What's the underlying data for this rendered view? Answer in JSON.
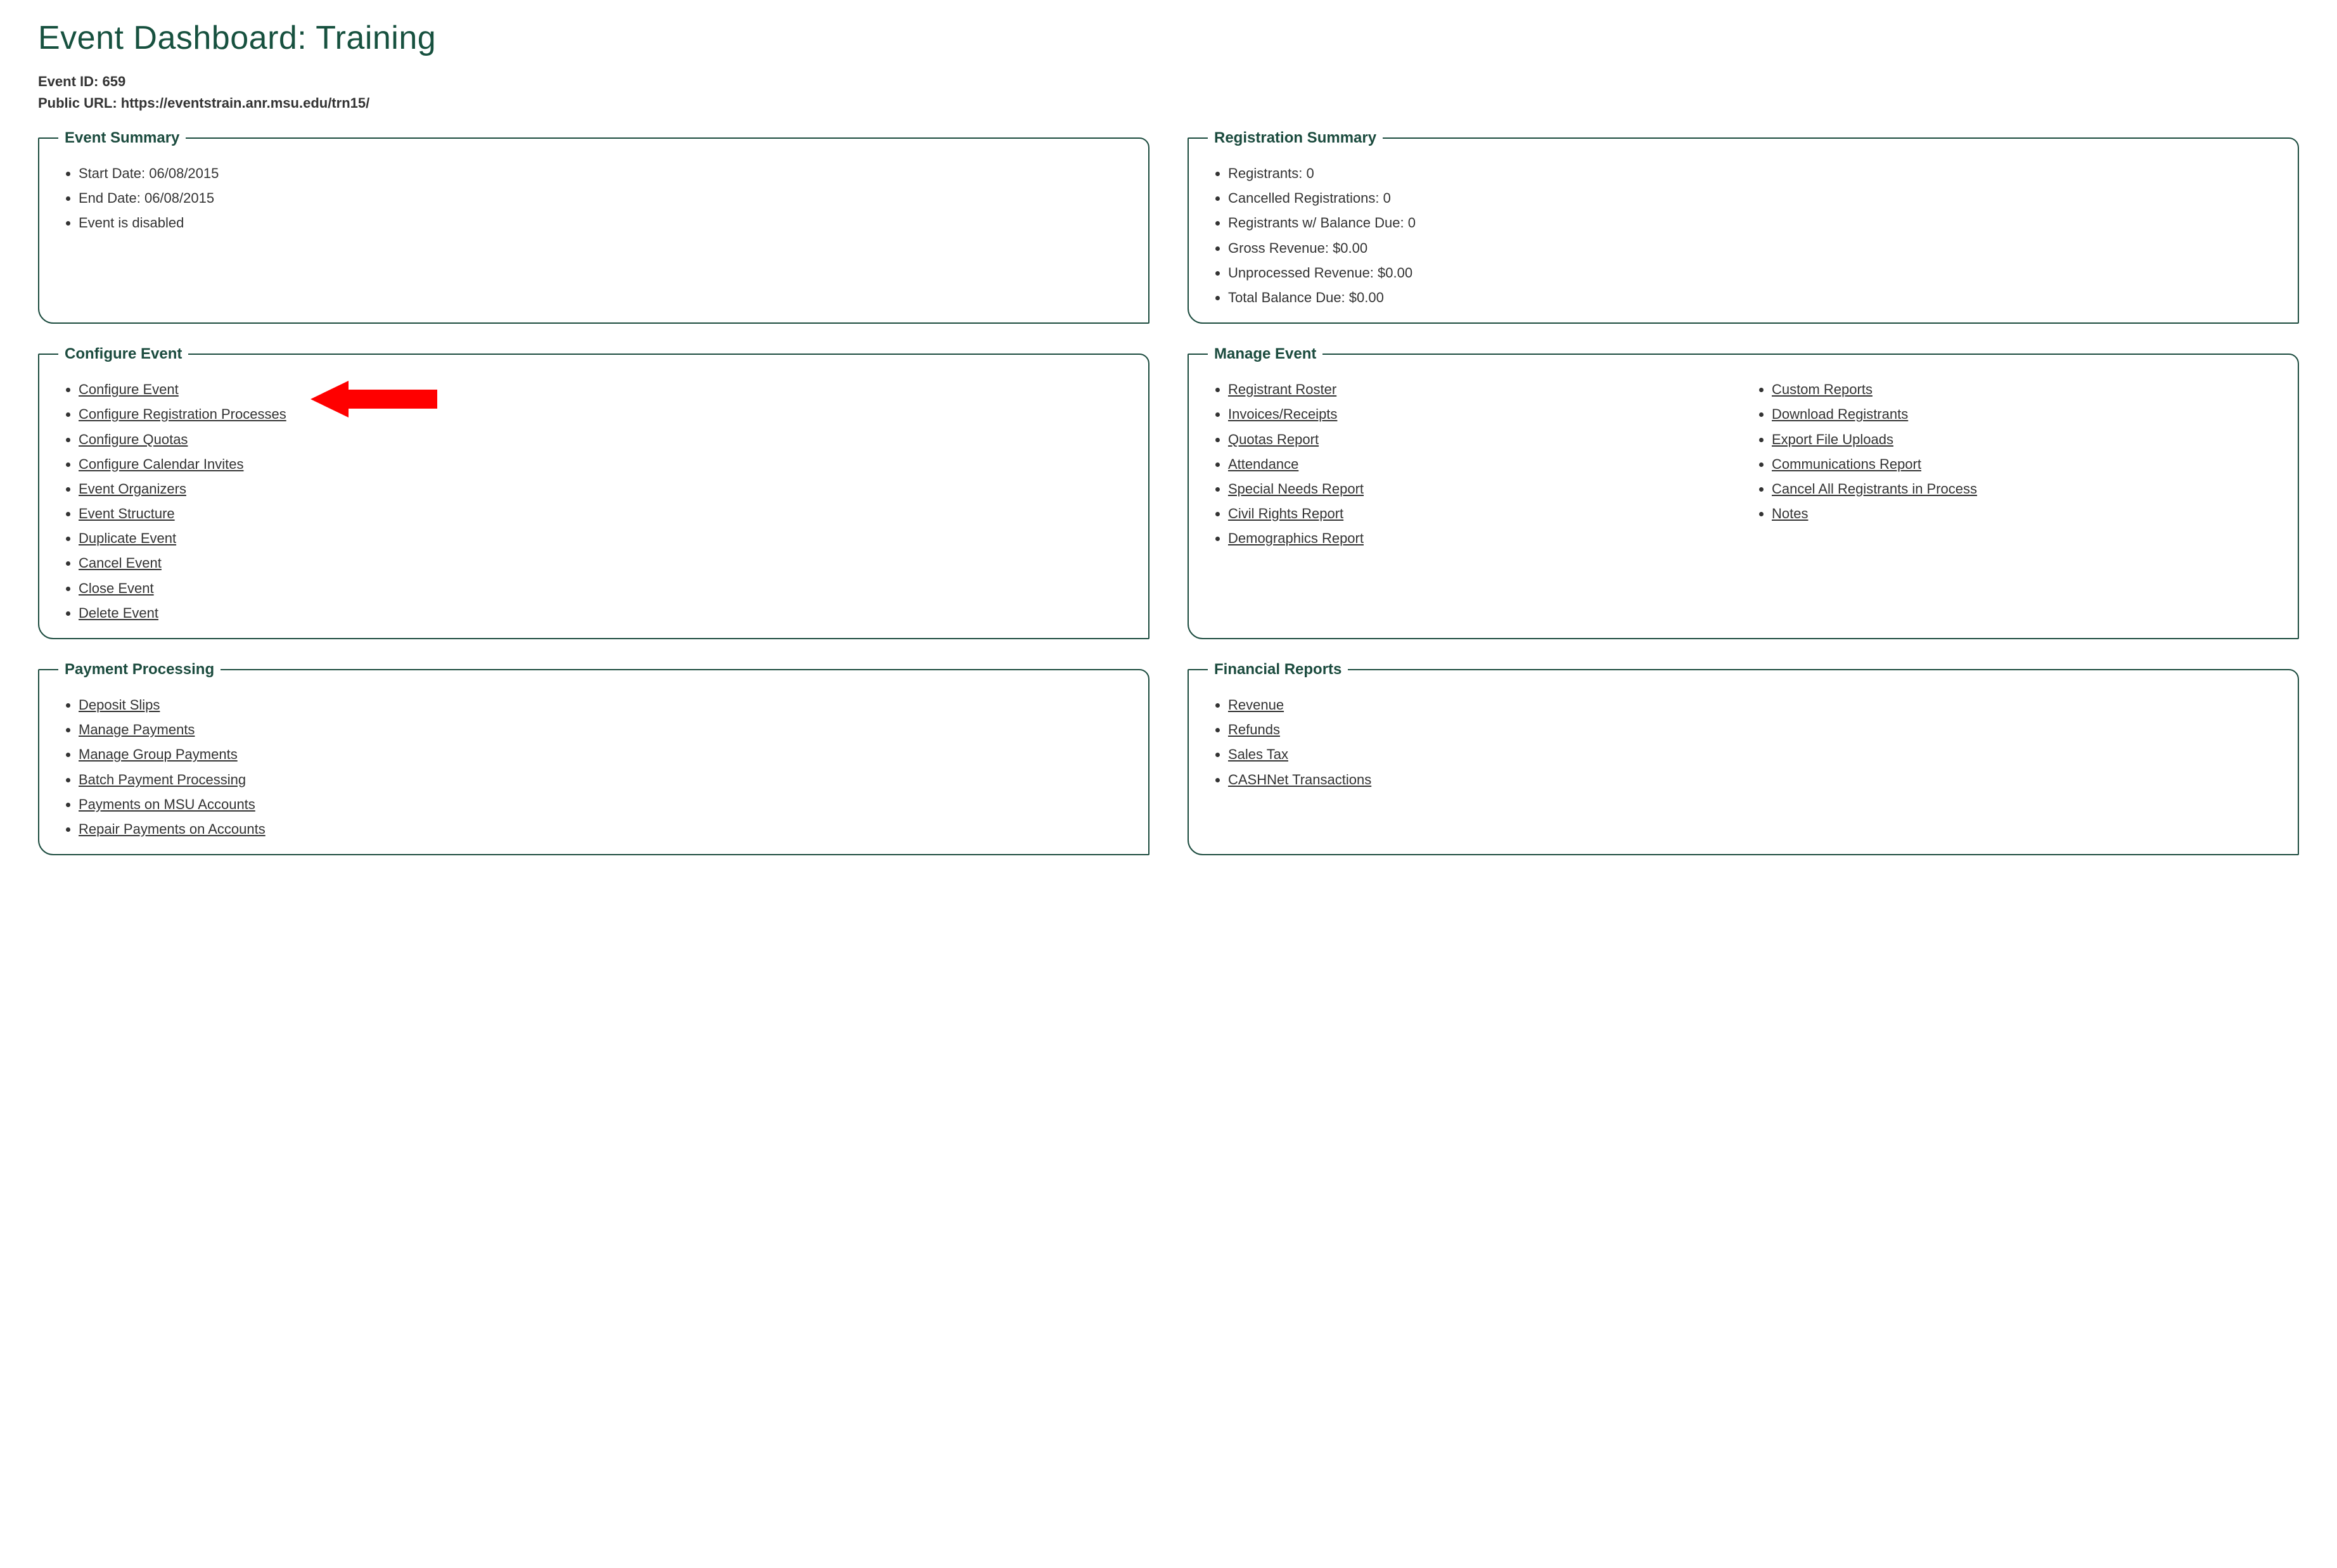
{
  "page": {
    "title": "Event Dashboard: Training",
    "event_id_label": "Event ID:",
    "event_id_value": "659",
    "public_url_label": "Public URL:",
    "public_url_value": "https://eventstrain.anr.msu.edu/trn15/"
  },
  "panels": {
    "event_summary": {
      "legend": "Event Summary",
      "items": [
        "Start Date: 06/08/2015",
        "End Date: 06/08/2015",
        "Event is disabled"
      ]
    },
    "registration_summary": {
      "legend": "Registration Summary",
      "items": [
        "Registrants: 0",
        "Cancelled Registrations: 0",
        "Registrants w/ Balance Due: 0",
        "Gross Revenue: $0.00",
        "Unprocessed Revenue: $0.00",
        "Total Balance Due: $0.00"
      ]
    },
    "configure_event": {
      "legend": "Configure Event",
      "links": [
        "Configure Event",
        "Configure Registration Processes",
        "Configure Quotas",
        "Configure Calendar Invites",
        "Event Organizers",
        "Event Structure",
        "Duplicate Event",
        "Cancel Event",
        "Close Event",
        "Delete Event"
      ]
    },
    "manage_event": {
      "legend": "Manage Event",
      "col1": [
        "Registrant Roster",
        "Invoices/Receipts",
        "Quotas Report",
        "Attendance",
        "Special Needs Report",
        "Civil Rights Report",
        "Demographics Report"
      ],
      "col2": [
        "Custom Reports",
        "Download Registrants",
        "Export File Uploads",
        "Communications Report",
        "Cancel All Registrants in Process",
        "Notes"
      ]
    },
    "payment_processing": {
      "legend": "Payment Processing",
      "links": [
        "Deposit Slips",
        "Manage Payments",
        "Manage Group Payments",
        "Batch Payment Processing",
        "Payments on MSU Accounts",
        "Repair Payments on Accounts"
      ]
    },
    "financial_reports": {
      "legend": "Financial Reports",
      "links": [
        "Revenue",
        "Refunds",
        "Sales Tax",
        "CASHNet Transactions"
      ]
    }
  }
}
